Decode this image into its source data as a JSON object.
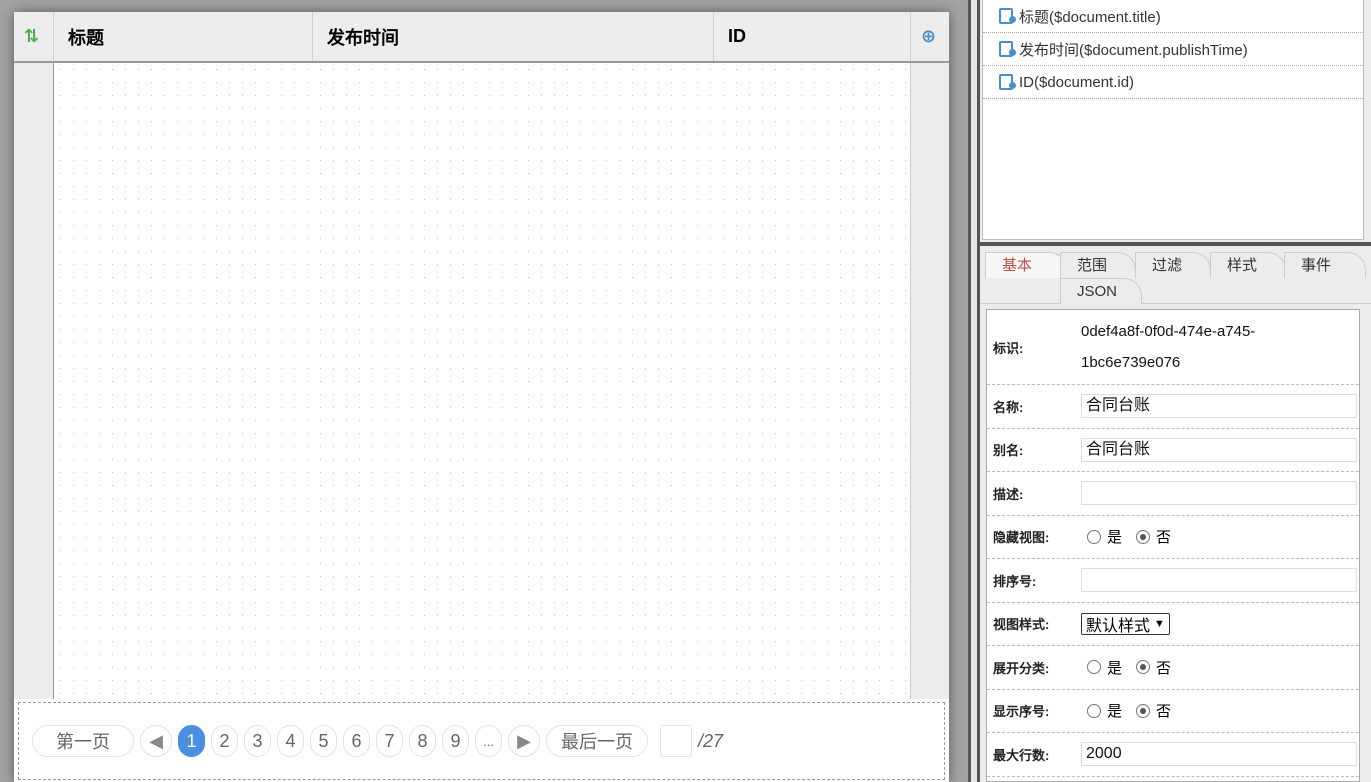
{
  "table": {
    "columns": [
      "标题",
      "发布时间",
      "ID"
    ]
  },
  "pager": {
    "first": "第一页",
    "last": "最后一页",
    "pages": [
      "1",
      "2",
      "3",
      "4",
      "5",
      "6",
      "7",
      "8",
      "9",
      "..."
    ],
    "current": "1",
    "total": "/27",
    "page_input": ""
  },
  "fields": [
    "标题($document.title)",
    "发布时间($document.publishTime)",
    "ID($document.id)"
  ],
  "tabs": [
    "基本",
    "范围",
    "过滤",
    "样式",
    "事件",
    "JSON"
  ],
  "form": {
    "id_label": "标识:",
    "id_value_1": "0def4a8f-0f0d-474e-a745-",
    "id_value_2": "1bc6e739e076",
    "name_label": "名称:",
    "name_value": "合同台账",
    "alias_label": "别名:",
    "alias_value": "合同台账",
    "desc_label": "描述:",
    "desc_value": "",
    "hide_label": "隐藏视图:",
    "yes": "是",
    "no": "否",
    "order_label": "排序号:",
    "order_value": "",
    "style_label": "视图样式:",
    "style_value": "默认样式",
    "expand_label": "展开分类:",
    "shownum_label": "显示序号:",
    "maxrows_label": "最大行数:",
    "maxrows_value": "2000"
  }
}
